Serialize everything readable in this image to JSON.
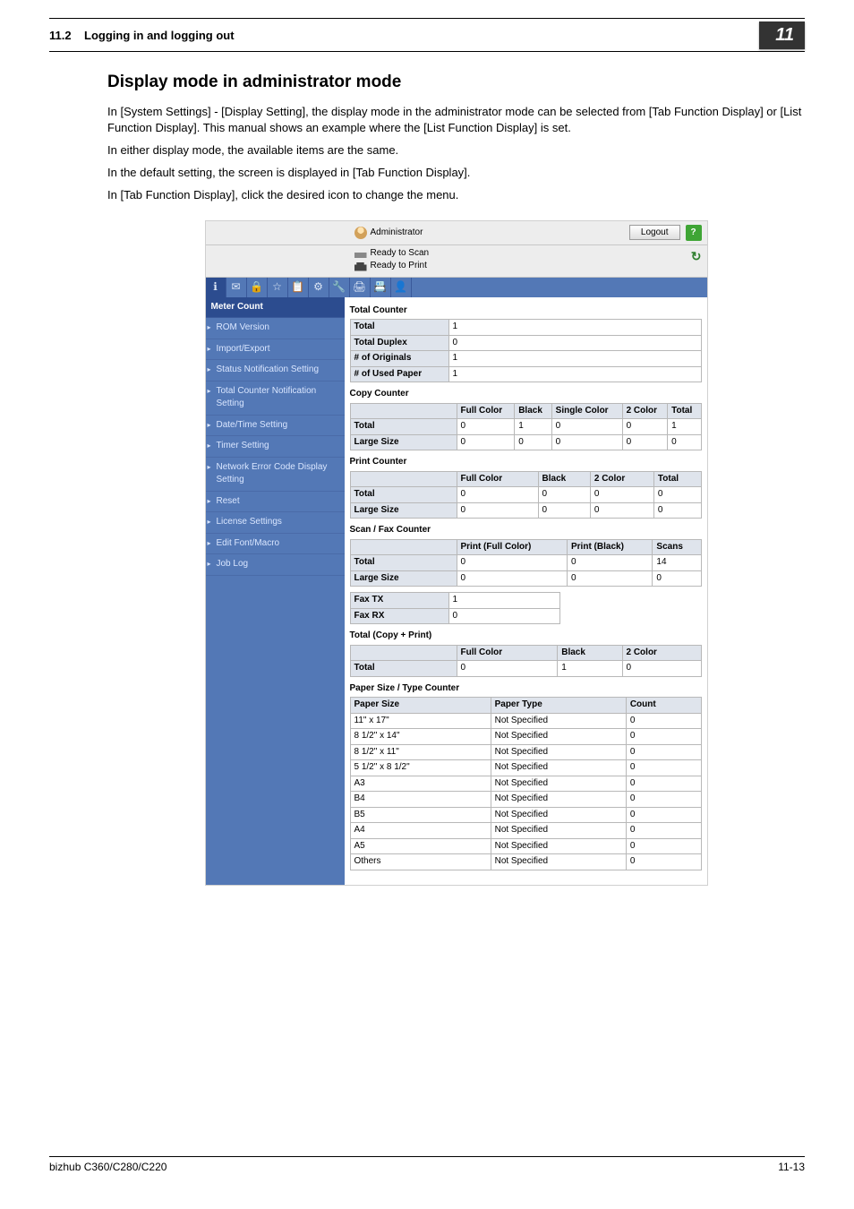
{
  "header": {
    "section_no": "11.2",
    "section_title": "Logging in and logging out",
    "badge": "11"
  },
  "body": {
    "h2": "Display mode in administrator mode",
    "p1": "In [System Settings] - [Display Setting], the display mode in the administrator mode can be selected from [Tab Function Display] or [List Function Display]. This manual shows an example where the [List Function Display] is set.",
    "p2": "In either display mode, the available items are the same.",
    "p3": "In the default setting, the screen is displayed in [Tab Function Display].",
    "p4": "In [Tab Function Display], click the desired icon to change the menu."
  },
  "shot": {
    "admin_label": "Administrator",
    "logout": "Logout",
    "status_scan": "Ready to Scan",
    "status_print": "Ready to Print",
    "nav_header": "Meter Count",
    "nav": [
      "ROM Version",
      "Import/Export",
      "Status Notification Setting",
      "Total Counter Notification Setting",
      "Date/Time Setting",
      "Timer Setting",
      "Network Error Code Display Setting",
      "Reset",
      "License Settings",
      "Edit Font/Macro",
      "Job Log"
    ],
    "total_counter": {
      "title": "Total Counter",
      "rows": [
        [
          "Total",
          "1"
        ],
        [
          "Total Duplex",
          "0"
        ],
        [
          "# of Originals",
          "1"
        ],
        [
          "# of Used Paper",
          "1"
        ]
      ]
    },
    "copy_counter": {
      "title": "Copy Counter",
      "cols": [
        "",
        "Full Color",
        "Black",
        "Single Color",
        "2 Color",
        "Total"
      ],
      "rows": [
        [
          "Total",
          "0",
          "1",
          "0",
          "0",
          "1"
        ],
        [
          "Large Size",
          "0",
          "0",
          "0",
          "0",
          "0"
        ]
      ]
    },
    "print_counter": {
      "title": "Print Counter",
      "cols": [
        "",
        "Full Color",
        "Black",
        "2 Color",
        "Total"
      ],
      "rows": [
        [
          "Total",
          "0",
          "0",
          "0",
          "0"
        ],
        [
          "Large Size",
          "0",
          "0",
          "0",
          "0"
        ]
      ]
    },
    "scanfax": {
      "title": "Scan / Fax Counter",
      "cols": [
        "",
        "Print (Full Color)",
        "Print (Black)",
        "Scans"
      ],
      "rows": [
        [
          "Total",
          "0",
          "0",
          "14"
        ],
        [
          "Large Size",
          "0",
          "0",
          "0"
        ]
      ],
      "fax": [
        [
          "Fax TX",
          "1"
        ],
        [
          "Fax RX",
          "0"
        ]
      ]
    },
    "tcp": {
      "title": "Total (Copy + Print)",
      "cols": [
        "",
        "Full Color",
        "Black",
        "2 Color"
      ],
      "rows": [
        [
          "Total",
          "0",
          "1",
          "0"
        ]
      ]
    },
    "pst": {
      "title": "Paper Size / Type Counter",
      "cols": [
        "Paper Size",
        "Paper Type",
        "Count"
      ],
      "rows": [
        [
          "11\" x 17\"",
          "Not Specified",
          "0"
        ],
        [
          "8 1/2\" x 14\"",
          "Not Specified",
          "0"
        ],
        [
          "8 1/2\" x 11\"",
          "Not Specified",
          "0"
        ],
        [
          "5 1/2\" x 8 1/2\"",
          "Not Specified",
          "0"
        ],
        [
          "A3",
          "Not Specified",
          "0"
        ],
        [
          "B4",
          "Not Specified",
          "0"
        ],
        [
          "B5",
          "Not Specified",
          "0"
        ],
        [
          "A4",
          "Not Specified",
          "0"
        ],
        [
          "A5",
          "Not Specified",
          "0"
        ],
        [
          "Others",
          "Not Specified",
          "0"
        ]
      ]
    }
  },
  "footer": {
    "model": "bizhub C360/C280/C220",
    "page": "11-13"
  }
}
